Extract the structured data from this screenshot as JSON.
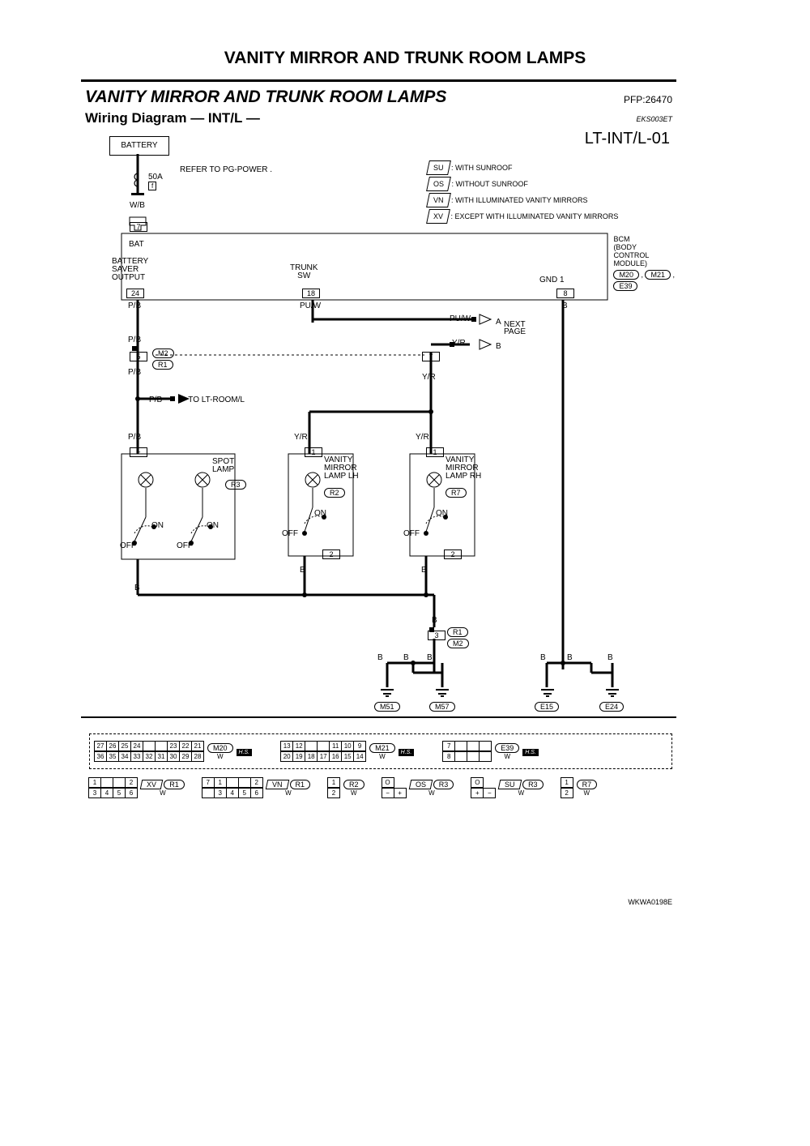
{
  "page_title": "VANITY MIRROR AND TRUNK ROOM LAMPS",
  "heading": "VANITY MIRROR AND TRUNK ROOM LAMPS",
  "pfp": "PFP:26470",
  "subheading": "Wiring Diagram — INT/L —",
  "seccode": "EKS003ET",
  "pagecode": "LT-INT/L-01",
  "battery": "BATTERY",
  "refer": "REFER TO  PG-POWER .",
  "fuse": {
    "amp": "50A",
    "letter": "f"
  },
  "legend": {
    "su": "SU",
    "su_text": ": WITH SUNROOF",
    "os": "OS",
    "os_text": ": WITHOUT SUNROOF",
    "vn": "VN",
    "vn_text": ": WITH ILLUMINATED VANITY MIRRORS",
    "xv": "XV",
    "xv_text": ": EXCEPT WITH ILLUMINATED VANITY MIRRORS"
  },
  "colors": {
    "wb": "W/B",
    "pb": "P/B",
    "puw": "PU/W",
    "yr": "Y/R",
    "b": "B"
  },
  "labels": {
    "bat": "BAT",
    "batt_saver": "BATTERY\nSAVER\nOUTPUT",
    "trunk_sw": "TRUNK\nSW",
    "gnd1": "GND 1",
    "next_page": "NEXT\nPAGE",
    "to_room": "TO LT-ROOM/L",
    "spot_lamp": "SPOT\nLAMP",
    "vanity_lh": "VANITY\nMIRROR\nLAMP LH",
    "vanity_rh": "VANITY\nMIRROR\nLAMP RH",
    "on": "ON",
    "off": "OFF"
  },
  "bcm": {
    "l1": "BCM",
    "l2": "(BODY",
    "l3": "CONTROL",
    "l4": "MODULE)",
    "c1": "M20",
    "c2": "M21",
    "c3": "E39"
  },
  "pins": {
    "p7": "7",
    "p24": "24",
    "p18": "18",
    "p8": "8",
    "p5": "5",
    "p1": "1",
    "p2": "2",
    "p3": "3",
    "plus": "+"
  },
  "conn": {
    "m2": "M2",
    "r1": "R1",
    "r2": "R2",
    "r3": "R3",
    "r7": "R7",
    "m51": "M51",
    "m57": "M57",
    "e15": "E15",
    "e24": "E24"
  },
  "connectors": {
    "white": "W",
    "hs": "H.S.",
    "top": [
      {
        "cells_top": [
          "27",
          "26",
          "25",
          "24",
          "",
          "",
          "23",
          "22",
          "21"
        ],
        "cells_bot": [
          "36",
          "35",
          "34",
          "33",
          "32",
          "31",
          "30",
          "29",
          "28"
        ],
        "id": "M20"
      },
      {
        "cells_top": [
          "13",
          "12",
          "",
          "",
          "11",
          "10",
          "9"
        ],
        "cells_bot": [
          "20",
          "19",
          "18",
          "17",
          "16",
          "15",
          "14"
        ],
        "id": "M21"
      },
      {
        "cells_top": [
          "7",
          "",
          "",
          ""
        ],
        "cells_bot": [
          "8",
          "",
          "",
          ""
        ],
        "id": "E39"
      }
    ],
    "bottom": [
      {
        "cells_top": [
          "1",
          "",
          "",
          "2"
        ],
        "cells_bot": [
          "3",
          "4",
          "5",
          "6"
        ],
        "tag": "XV",
        "id": "R1"
      },
      {
        "cells_top": [
          "7",
          "1",
          "",
          "",
          "2"
        ],
        "cells_bot": [
          "",
          "3",
          "4",
          "5",
          "6"
        ],
        "tag": "VN",
        "id": "R1"
      },
      {
        "cells_top": [
          "1"
        ],
        "cells_bot": [
          "2"
        ],
        "id": "R2"
      },
      {
        "cells_top": [
          "O"
        ],
        "cells_bot": [
          "−",
          "+"
        ],
        "tag": "OS",
        "id": "R3"
      },
      {
        "cells_top": [
          "O"
        ],
        "cells_bot": [
          "+",
          "−"
        ],
        "tag": "SU",
        "id": "R3"
      },
      {
        "cells_top": [
          "1"
        ],
        "cells_bot": [
          "2"
        ],
        "id": "R7"
      }
    ]
  },
  "arrows": {
    "a": "A",
    "b": "B"
  },
  "wkcode": "WKWA0198E"
}
